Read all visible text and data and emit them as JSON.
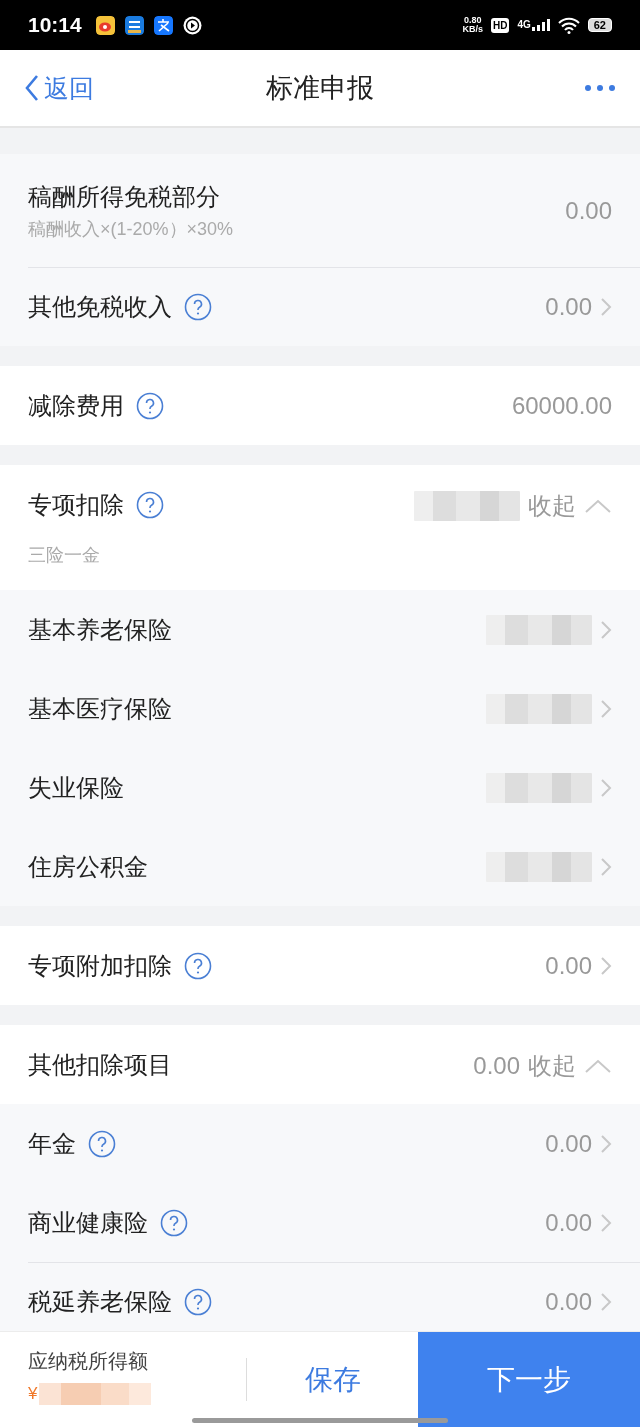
{
  "status_bar": {
    "time": "10:14",
    "net_speed": "0.80",
    "net_unit": "KB/s",
    "hd": "HD",
    "network": "4G",
    "battery": "62"
  },
  "nav": {
    "back": "返回",
    "title": "标准申报"
  },
  "sections": [
    {
      "rows": [
        {
          "kind": "sub",
          "label": "稿酬所得免税部分",
          "subtitle": "稿酬收入×(1-20%）×30%",
          "help": false,
          "value": "0.00",
          "chevron": false,
          "divider_above": false
        },
        {
          "kind": "sub",
          "label": "其他免税收入",
          "help": true,
          "value": "0.00",
          "chevron": true,
          "divider_above": true
        }
      ]
    },
    {
      "rows": [
        {
          "kind": "item",
          "label": "减除费用",
          "help": true,
          "value": "60000.00",
          "chevron": false,
          "divider_above": false
        }
      ]
    },
    {
      "rows": [
        {
          "kind": "header",
          "label": "专项扣除",
          "subtitle": "三险一金",
          "help": true,
          "value_blurred": true,
          "toggle_label": "收起",
          "expanded": true,
          "divider_above": false
        },
        {
          "kind": "sub",
          "label": "基本养老保险",
          "help": false,
          "value_blurred": true,
          "chevron": true,
          "divider_above": false
        },
        {
          "kind": "sub",
          "label": "基本医疗保险",
          "help": false,
          "value_blurred": true,
          "chevron": true,
          "divider_above": false
        },
        {
          "kind": "sub",
          "label": "失业保险",
          "help": false,
          "value_blurred": true,
          "chevron": true,
          "divider_above": false
        },
        {
          "kind": "sub",
          "label": "住房公积金",
          "help": false,
          "value_blurred": true,
          "chevron": true,
          "divider_above": false
        }
      ]
    },
    {
      "rows": [
        {
          "kind": "item",
          "label": "专项附加扣除",
          "help": true,
          "value": "0.00",
          "chevron": true,
          "divider_above": false
        }
      ]
    },
    {
      "rows": [
        {
          "kind": "header",
          "label": "其他扣除项目",
          "help": false,
          "value": "0.00",
          "toggle_label": "收起",
          "expanded": true,
          "divider_above": false
        },
        {
          "kind": "sub",
          "label": "年金",
          "help": true,
          "value": "0.00",
          "chevron": true,
          "divider_above": false
        },
        {
          "kind": "sub",
          "label": "商业健康险",
          "help": true,
          "value": "0.00",
          "chevron": true,
          "divider_above": false
        },
        {
          "kind": "sub",
          "label": "税延养老保险",
          "help": true,
          "value": "0.00",
          "chevron": true,
          "divider_above": true
        }
      ]
    }
  ],
  "footer": {
    "label": "应纳税所得额",
    "currency": "¥",
    "amount_blurred": true,
    "save": "保存",
    "next": "下一步"
  }
}
